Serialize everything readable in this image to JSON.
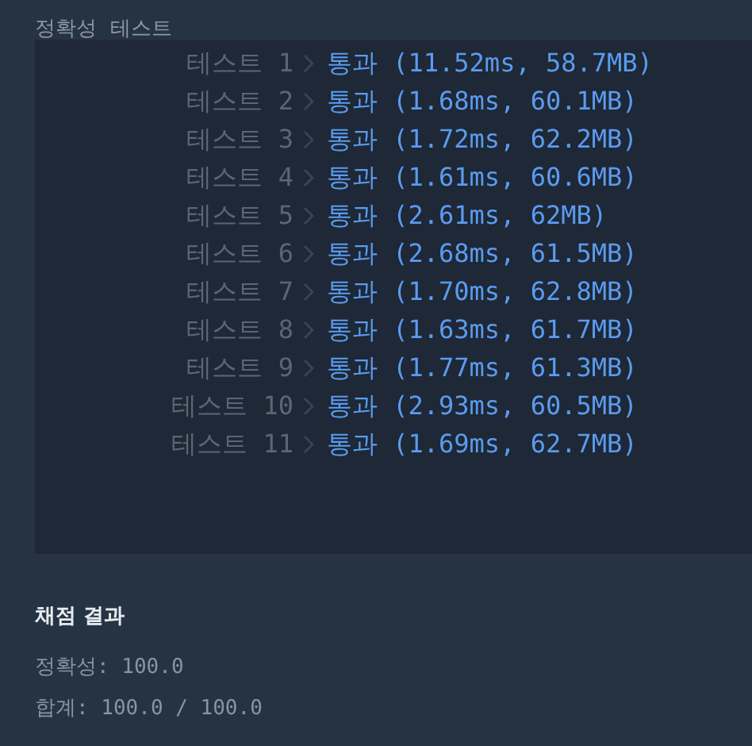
{
  "section_title": "정확성  테스트",
  "tests": [
    {
      "label": "테스트 1",
      "result": "통과 (11.52ms, 58.7MB)"
    },
    {
      "label": "테스트 2",
      "result": "통과 (1.68ms, 60.1MB)"
    },
    {
      "label": "테스트 3",
      "result": "통과 (1.72ms, 62.2MB)"
    },
    {
      "label": "테스트 4",
      "result": "통과 (1.61ms, 60.6MB)"
    },
    {
      "label": "테스트 5",
      "result": "통과 (2.61ms, 62MB)"
    },
    {
      "label": "테스트 6",
      "result": "통과 (2.68ms, 61.5MB)"
    },
    {
      "label": "테스트 7",
      "result": "통과 (1.70ms, 62.8MB)"
    },
    {
      "label": "테스트 8",
      "result": "통과 (1.63ms, 61.7MB)"
    },
    {
      "label": "테스트 9",
      "result": "통과 (1.77ms, 61.3MB)"
    },
    {
      "label": "테스트 10",
      "result": "통과 (2.93ms, 60.5MB)"
    },
    {
      "label": "테스트 11",
      "result": "통과 (1.69ms, 62.7MB)"
    }
  ],
  "summary": {
    "title": "채점 결과",
    "lines": [
      "정확성: 100.0",
      "합계: 100.0 / 100.0"
    ]
  }
}
